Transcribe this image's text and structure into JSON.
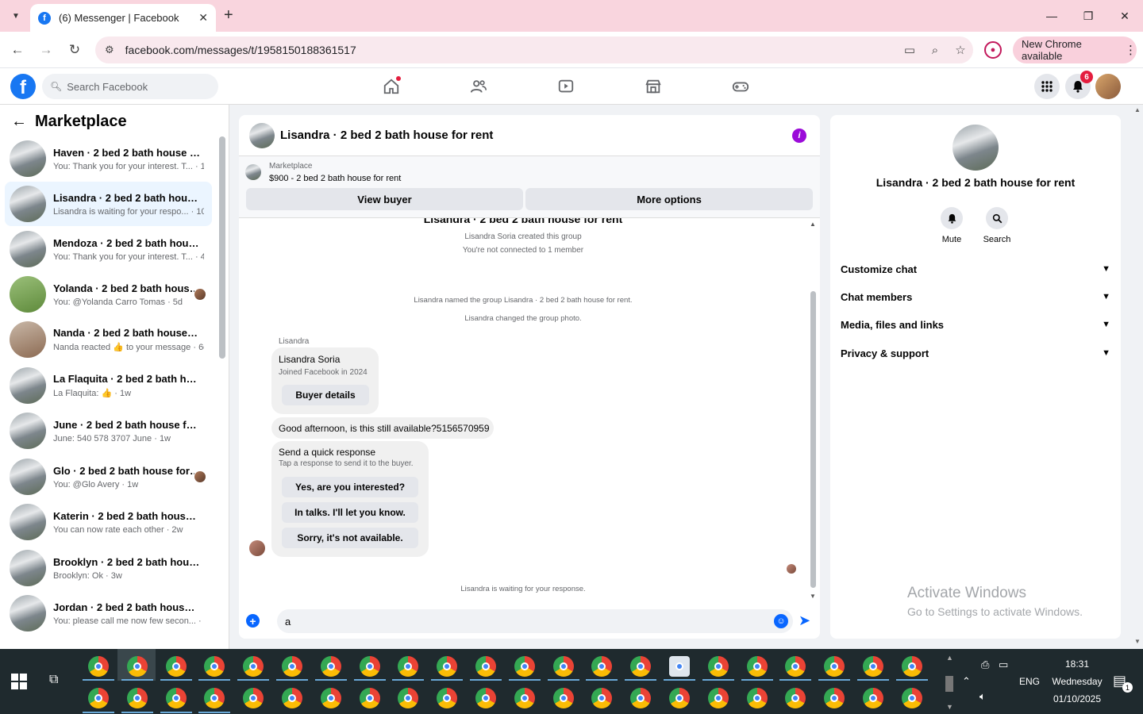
{
  "browser": {
    "tab_title": "(6) Messenger | Facebook",
    "url": "facebook.com/messages/t/1958150188361517",
    "new_chrome": "New Chrome available"
  },
  "fb": {
    "search_placeholder": "Search Facebook",
    "notif_count": "6",
    "brand_color": "#1877f2"
  },
  "sidebar": {
    "title": "Marketplace",
    "conversations": [
      {
        "name": "Haven · 2 bed 2 bath house for ...",
        "preview": "You: Thank you for your interest. T... · 1h"
      },
      {
        "name": "Lisandra · 2 bed 2 bath house f...",
        "preview": "Lisandra is waiting for your respo... · 10h"
      },
      {
        "name": "Mendoza · 2 bed 2 bath house f...",
        "preview": "You: Thank you for your interest. T... · 4d"
      },
      {
        "name": "Yolanda · 2 bed 2 bath house ...",
        "preview": "You: @Yolanda Carro Tomas · 5d"
      },
      {
        "name": "Nanda · 2 bed 2 bath house for ...",
        "preview": "Nanda reacted 👍 to your message · 6d"
      },
      {
        "name": "La Flaquita · 2 bed 2 bath house...",
        "preview": "La Flaquita: 👍 · 1w"
      },
      {
        "name": "June · 2 bed 2 bath house for re...",
        "preview": "June: 540 578 3707 June · 1w"
      },
      {
        "name": "Glo · 2 bed 2 bath house for r...",
        "preview": "You: @Glo Avery · 1w"
      },
      {
        "name": "Katerin · 2 bed 2 bath house for...",
        "preview": "You can now rate each other · 2w"
      },
      {
        "name": "Brooklyn · 2 bed 2 bath house f...",
        "preview": "Brooklyn: Ok · 3w"
      },
      {
        "name": "Jordan · 2 bed 2 bath house for ...",
        "preview": "You: please call me now few secon... · 3w"
      }
    ]
  },
  "chat": {
    "title": "Lisandra · 2 bed 2 bath house for rent",
    "marketplace_label": "Marketplace",
    "listing": "$900 - 2 bed 2 bath house for rent",
    "view_buyer": "View buyer",
    "more_options": "More options",
    "group_name": "Lisandra · 2 bed 2 bath house for rent",
    "created": "Lisandra Soria created this group",
    "not_connected": "You're not connected to 1 member",
    "named_group": "Lisandra named the group Lisandra · 2 bed 2 bath house for rent.",
    "changed_photo": "Lisandra changed the group photo.",
    "sender": "Lisandra",
    "buyer_name": "Lisandra Soria",
    "joined": "Joined Facebook in 2024",
    "buyer_details": "Buyer details",
    "message": "Good afternoon, is this still available?5156570959",
    "qr_title": "Send a quick response",
    "qr_sub": "Tap a response to send it to the buyer.",
    "qr_options": [
      "Yes, are you interested?",
      "In talks. I'll let you know.",
      "Sorry, it's not available."
    ],
    "waiting": "Lisandra is waiting for your response.",
    "input_value": "a"
  },
  "rpanel": {
    "name": "Lisandra · 2 bed 2 bath house for rent",
    "mute": "Mute",
    "search": "Search",
    "sections": [
      "Customize chat",
      "Chat members",
      "Media, files and links",
      "Privacy & support"
    ]
  },
  "watermark": {
    "line1": "Activate Windows",
    "line2": "Go to Settings to activate Windows."
  },
  "tray": {
    "lang": "ENG",
    "time": "18:31",
    "day": "Wednesday",
    "date": "01/10/2025",
    "notif": "1"
  }
}
